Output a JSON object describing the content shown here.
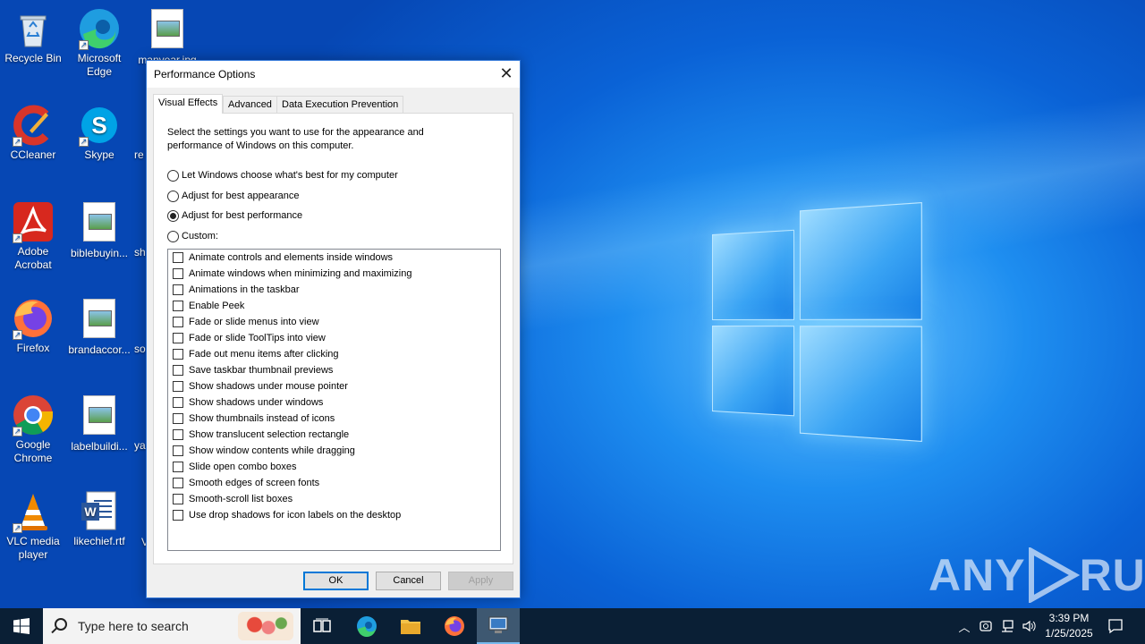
{
  "desktop": {
    "icons": [
      {
        "label": "Recycle Bin",
        "icon": "recycle-bin-icon"
      },
      {
        "label": "Microsoft Edge",
        "icon": "edge-icon"
      },
      {
        "label": "manyear.jpg",
        "icon": "image-file-icon"
      },
      {
        "label": "CCleaner",
        "icon": "ccleaner-icon"
      },
      {
        "label": "Skype",
        "icon": "skype-icon"
      },
      {
        "label": "Adobe Acrobat",
        "icon": "acrobat-icon"
      },
      {
        "label": "biblebuyin...",
        "icon": "image-file-icon"
      },
      {
        "label": "Firefox",
        "icon": "firefox-icon"
      },
      {
        "label": "brandaccor...",
        "icon": "image-file-icon"
      },
      {
        "label": "Google Chrome",
        "icon": "chrome-icon"
      },
      {
        "label": "labelbuildi...",
        "icon": "image-file-icon"
      },
      {
        "label": "VLC media player",
        "icon": "vlc-icon"
      },
      {
        "label": "likechief.rtf",
        "icon": "word-file-icon"
      }
    ],
    "partial_labels": [
      "re",
      "sh",
      "so",
      "ya",
      "V"
    ]
  },
  "dialog": {
    "title": "Performance Options",
    "tabs": [
      {
        "label": "Visual Effects",
        "active": true
      },
      {
        "label": "Advanced",
        "active": false
      },
      {
        "label": "Data Execution Prevention",
        "active": false
      }
    ],
    "description": "Select the settings you want to use for the appearance and performance of Windows on this computer.",
    "radios": [
      {
        "label": "Let Windows choose what's best for my computer",
        "checked": false
      },
      {
        "label": "Adjust for best appearance",
        "checked": false
      },
      {
        "label": "Adjust for best performance",
        "checked": true
      },
      {
        "label": "Custom:",
        "checked": false
      }
    ],
    "options": [
      {
        "label": "Animate controls and elements inside windows",
        "checked": false
      },
      {
        "label": "Animate windows when minimizing and maximizing",
        "checked": false
      },
      {
        "label": "Animations in the taskbar",
        "checked": false
      },
      {
        "label": "Enable Peek",
        "checked": false
      },
      {
        "label": "Fade or slide menus into view",
        "checked": false
      },
      {
        "label": "Fade or slide ToolTips into view",
        "checked": false
      },
      {
        "label": "Fade out menu items after clicking",
        "checked": false
      },
      {
        "label": "Save taskbar thumbnail previews",
        "checked": false
      },
      {
        "label": "Show shadows under mouse pointer",
        "checked": false
      },
      {
        "label": "Show shadows under windows",
        "checked": false
      },
      {
        "label": "Show thumbnails instead of icons",
        "checked": false
      },
      {
        "label": "Show translucent selection rectangle",
        "checked": false
      },
      {
        "label": "Show window contents while dragging",
        "checked": false
      },
      {
        "label": "Slide open combo boxes",
        "checked": false
      },
      {
        "label": "Smooth edges of screen fonts",
        "checked": false
      },
      {
        "label": "Smooth-scroll list boxes",
        "checked": false
      },
      {
        "label": "Use drop shadows for icon labels on the desktop",
        "checked": false
      }
    ],
    "buttons": {
      "ok": "OK",
      "cancel": "Cancel",
      "apply": "Apply"
    }
  },
  "taskbar": {
    "search_placeholder": "Type here to search",
    "time": "3:39 PM",
    "date": "1/25/2025"
  },
  "watermark": {
    "left": "ANY",
    "right": "RUN"
  }
}
